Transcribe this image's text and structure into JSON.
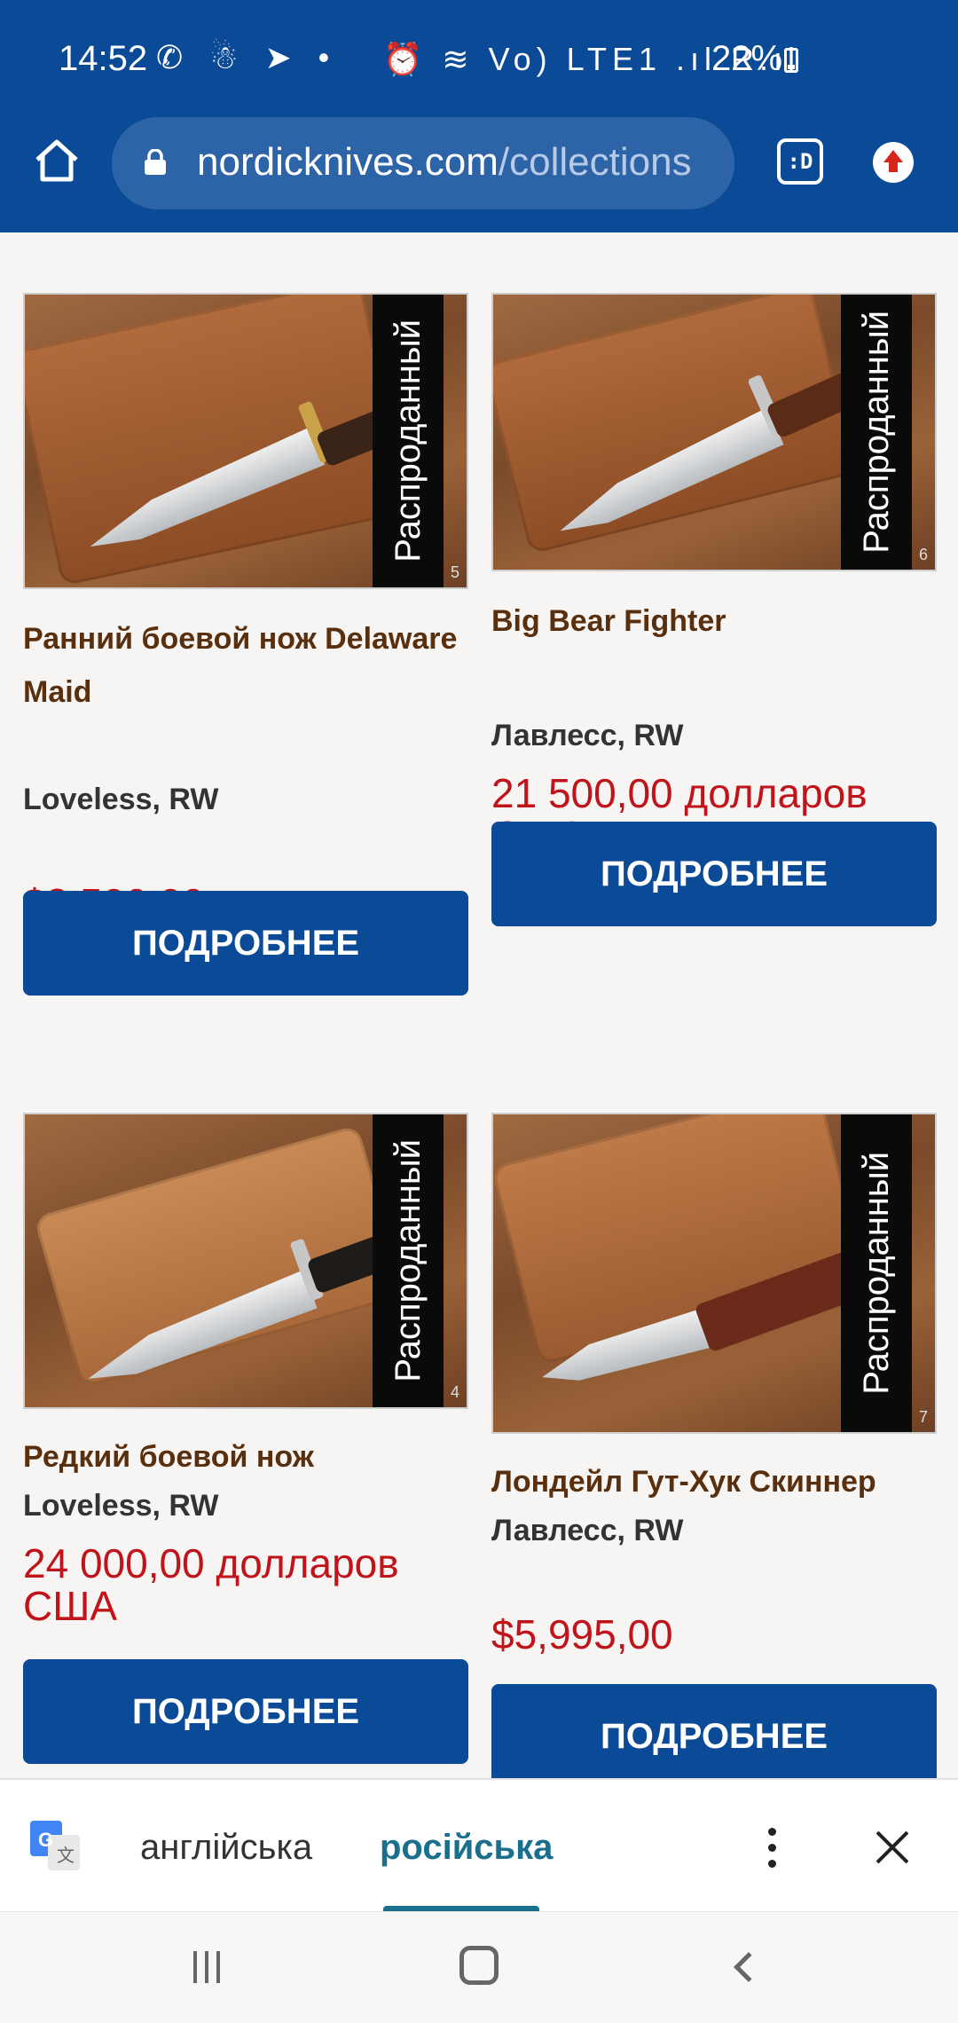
{
  "status_bar": {
    "time": "14:52",
    "left_icons": "✆ ☃ ➤ •",
    "right_icons": "⏰ ≋ Vo) LTE1 .ıl R.ıl",
    "battery": "22%"
  },
  "browser": {
    "url_host": "nordicknives.com",
    "url_path": "/collections",
    "tab_switcher_label": ":D"
  },
  "products": [
    {
      "title": "Ранний боевой нож Delaware Maid",
      "maker": "Loveless, RW",
      "price": "$8,500,00",
      "badge": "Распроданный",
      "image_number": "5",
      "button": "ПОДРОБНЕЕ"
    },
    {
      "title": "Big Bear Fighter",
      "maker": "Лавлесс, RW",
      "price": "21 500,00 долларов США",
      "badge": "Распроданный",
      "image_number": "6",
      "button": "ПОДРОБНЕЕ"
    },
    {
      "title": "Редкий боевой нож",
      "maker": "Loveless, RW",
      "price": "24 000,00 долларов США",
      "badge": "Распроданный",
      "image_number": "4",
      "button": "ПОДРОБНЕЕ"
    },
    {
      "title": "Лондейл Гут-Хук Скиннер",
      "maker": "Лавлесс, RW",
      "price": "$5,995,00",
      "badge": "Распроданный",
      "image_number": "7",
      "button": "ПОДРОБНЕЕ"
    }
  ],
  "translate_bar": {
    "source_language": "англійська",
    "target_language": "російська"
  },
  "colors": {
    "brand_blue": "#0b4a96",
    "price_red": "#c0141a",
    "title_brown": "#5a2f0e"
  }
}
